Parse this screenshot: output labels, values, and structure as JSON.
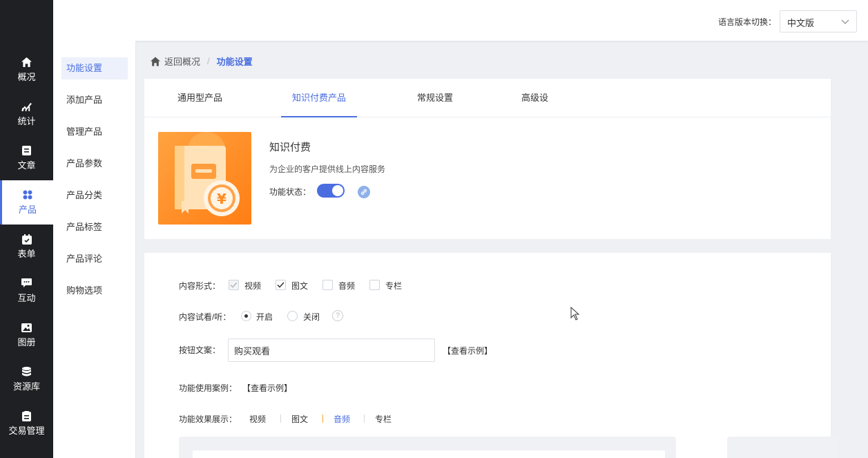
{
  "topbar": {
    "lang_label": "语言版本切换：",
    "lang_value": "中文版"
  },
  "sidebar": {
    "items": [
      {
        "label": "概况",
        "icon": "home-icon"
      },
      {
        "label": "统计",
        "icon": "chart-icon"
      },
      {
        "label": "文章",
        "icon": "article-icon"
      },
      {
        "label": "产品",
        "icon": "grid-icon",
        "active": true
      },
      {
        "label": "表单",
        "icon": "form-icon"
      },
      {
        "label": "互动",
        "icon": "message-icon"
      },
      {
        "label": "图册",
        "icon": "gallery-icon"
      },
      {
        "label": "资源库",
        "icon": "database-icon"
      },
      {
        "label": "交易管理",
        "icon": "order-icon"
      }
    ]
  },
  "submenu": {
    "items": [
      {
        "label": "功能设置",
        "active": true
      },
      {
        "label": "添加产品"
      },
      {
        "label": "管理产品"
      },
      {
        "label": "产品参数"
      },
      {
        "label": "产品分类"
      },
      {
        "label": "产品标签"
      },
      {
        "label": "产品评论"
      },
      {
        "label": "购物选项"
      }
    ]
  },
  "breadcrumb": {
    "back": "返回概况",
    "separator": "/",
    "current": "功能设置"
  },
  "tabs": [
    {
      "label": "通用型产品"
    },
    {
      "label": "知识付费产品",
      "active": true
    },
    {
      "label": "常规设置"
    },
    {
      "label": "高级设"
    }
  ],
  "feature": {
    "title": "知识付费",
    "description": "为企业的客户提供线上内容服务",
    "status_label": "功能状态：",
    "status_on": true,
    "accent_color": "#4a6ee0",
    "image_color": "#ff8a20"
  },
  "settings": {
    "content_form_label": "内容形式：",
    "content_forms": [
      {
        "label": "视频",
        "checked": true,
        "disabled": true
      },
      {
        "label": "图文",
        "checked": true
      },
      {
        "label": "音频",
        "checked": false
      },
      {
        "label": "专栏",
        "checked": false
      }
    ],
    "trial_label": "内容试看/听：",
    "trial_options": [
      {
        "label": "开启",
        "selected": true
      },
      {
        "label": "关闭",
        "selected": false
      }
    ],
    "trial_help": "?",
    "button_text_label": "按钮文案：",
    "button_text_value": "购买观看",
    "view_example": "【查看示例】",
    "case_label": "功能使用案例：",
    "case_link": "【查看示例】",
    "effect_label": "功能效果展示：",
    "effect_tabs": [
      {
        "label": "视频"
      },
      {
        "label": "图文"
      },
      {
        "label": "音频",
        "active": true
      },
      {
        "label": "专栏"
      }
    ]
  }
}
